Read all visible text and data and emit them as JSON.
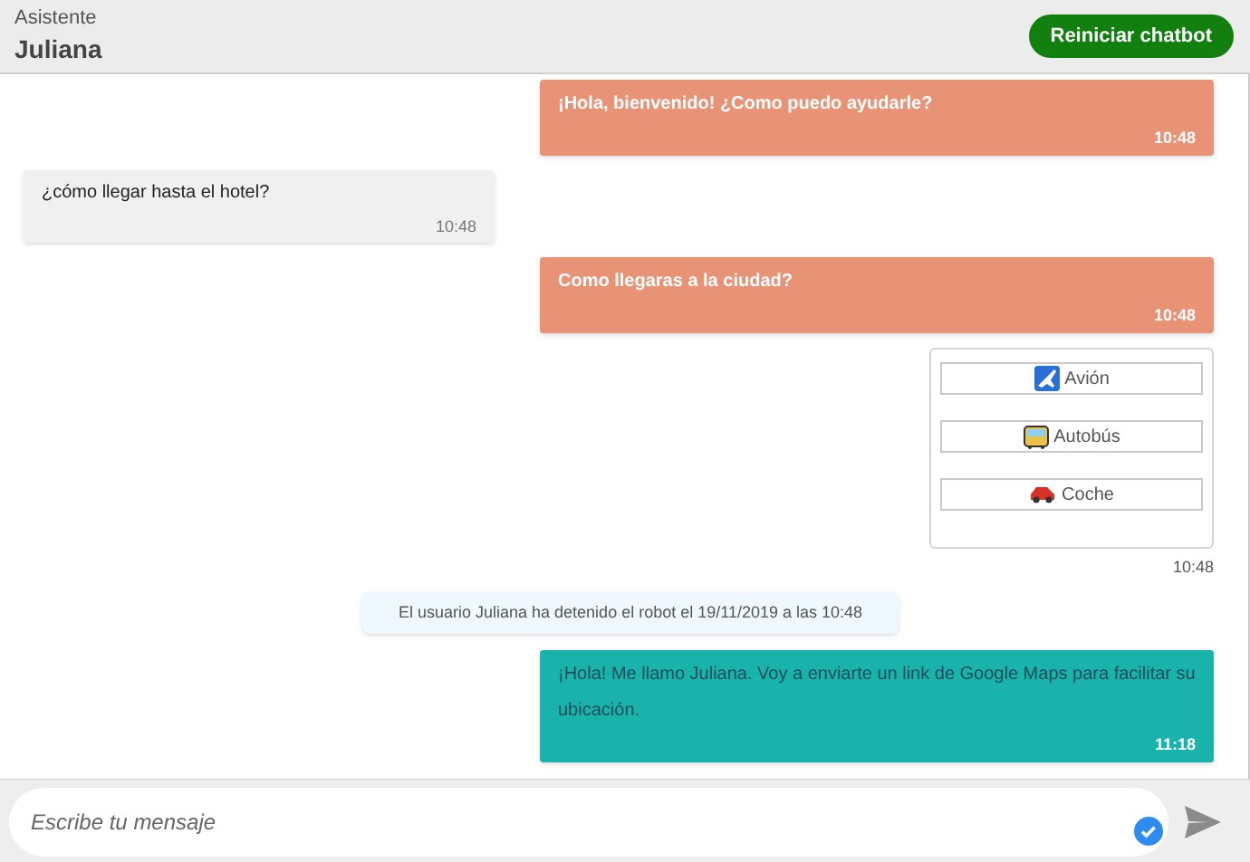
{
  "header": {
    "subtitle": "Asistente",
    "title": "Juliana",
    "restart_button": "Reiniciar chatbot"
  },
  "messages": [
    {
      "kind": "bot",
      "text": "¡Hola, bienvenido! ¿Como puedo ayudarle?",
      "time": "10:48"
    },
    {
      "kind": "user",
      "text": "¿cómo llegar hasta el hotel?",
      "time": "10:48"
    },
    {
      "kind": "bot",
      "text": "Como llegaras a la ciudad?",
      "time": "10:48"
    },
    {
      "kind": "options",
      "options": [
        {
          "label": "Avión",
          "kind": "plane"
        },
        {
          "label": "Autobús",
          "kind": "bus"
        },
        {
          "label": "Coche",
          "kind": "car"
        }
      ],
      "time": "10:48"
    },
    {
      "kind": "system",
      "text": "El usuario Juliana ha detenido el robot el 19/11/2019 a las 10:48"
    },
    {
      "kind": "agent",
      "text": "¡Hola! Me llamo Juliana. Voy a enviarte un link de Google Maps para facilitar su ubicación.",
      "time": "11:18"
    }
  ],
  "composer": {
    "placeholder": "Escribe tu mensaje"
  }
}
